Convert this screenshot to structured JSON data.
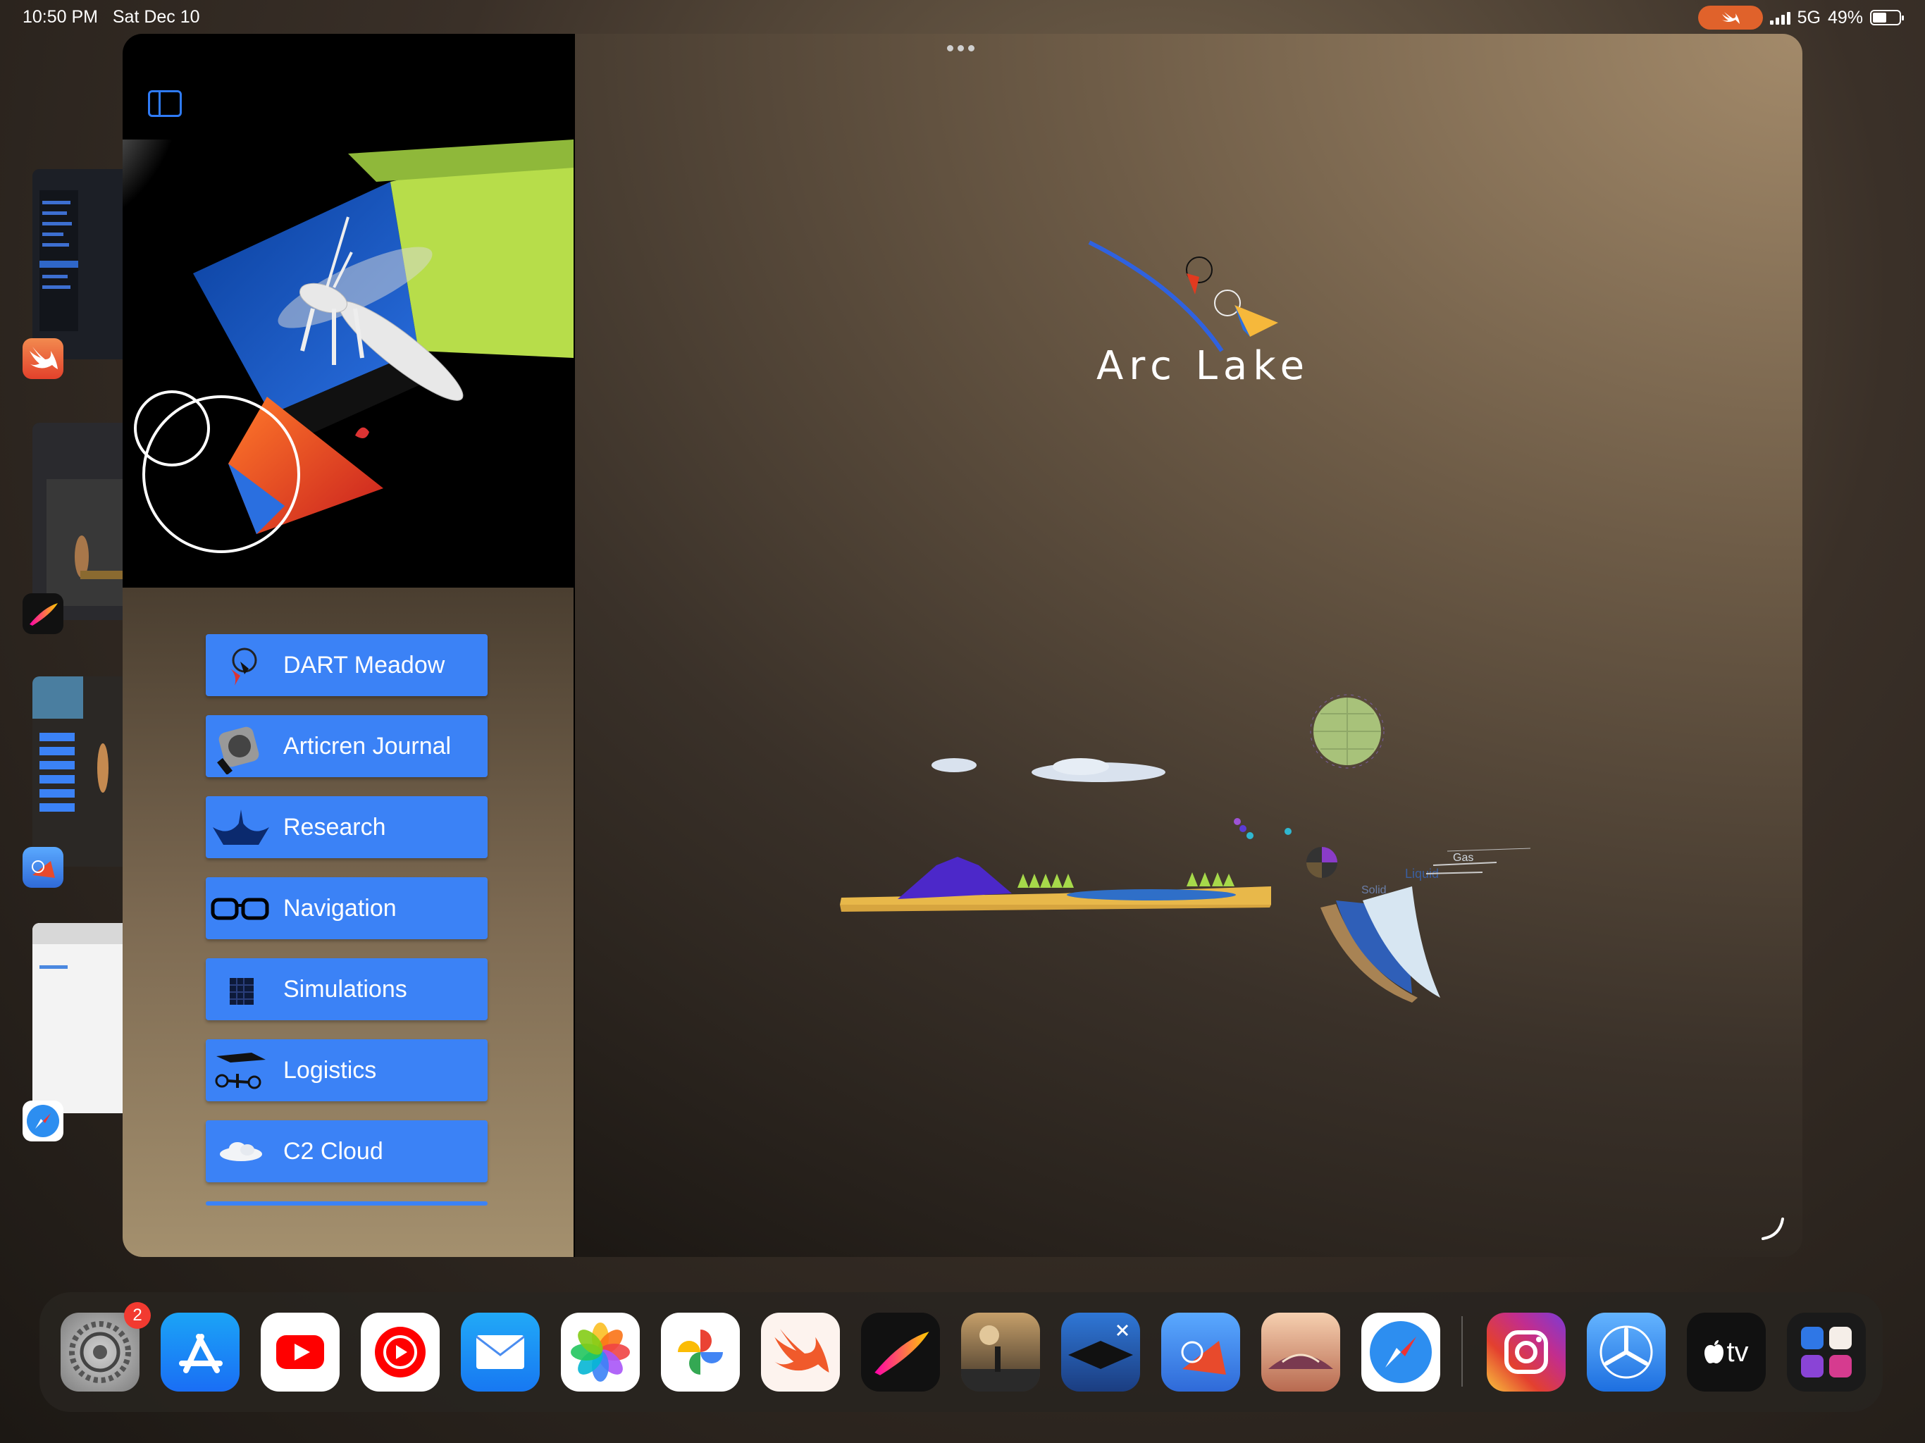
{
  "status_bar": {
    "time": "10:50 PM",
    "date": "Sat Dec 10",
    "network": "5G",
    "battery": "49%"
  },
  "app_switcher": {
    "thumbnails": [
      {
        "app": "Swift Playgrounds",
        "icon": "swift-icon"
      },
      {
        "app": "Procreate",
        "icon": "procreate-icon"
      },
      {
        "app": "Arc Lake app",
        "icon": "arc-lake-app-icon"
      },
      {
        "app": "Safari",
        "icon": "safari-icon"
      }
    ]
  },
  "window": {
    "menu_items": [
      {
        "label": "DART Meadow",
        "icon": "dart-meadow-icon"
      },
      {
        "label": "Articren Journal",
        "icon": "journal-watch-icon"
      },
      {
        "label": "Research",
        "icon": "research-icon"
      },
      {
        "label": "Navigation",
        "icon": "glasses-icon"
      },
      {
        "label": "Simulations",
        "icon": "cube-icon"
      },
      {
        "label": "Logistics",
        "icon": "drone-icon"
      },
      {
        "label": "C2 Cloud",
        "icon": "cloud-icon"
      }
    ],
    "logo_text": "Arc Lake",
    "scene_labels": {
      "solid": "Solid",
      "liquid": "Liquid",
      "gas": "Gas"
    }
  },
  "dock": {
    "settings_badge": "2",
    "apps": [
      "Settings",
      "App Store",
      "YouTube",
      "YouTube Music",
      "Mail",
      "Photos",
      "Google Photos",
      "Swift Playgrounds",
      "Procreate",
      "Game",
      "Game 2",
      "Arc Lake app",
      "Sky app",
      "Safari",
      "Instagram",
      "TestFlight",
      "Apple TV",
      "App Library"
    ],
    "tv_label": "tv"
  }
}
